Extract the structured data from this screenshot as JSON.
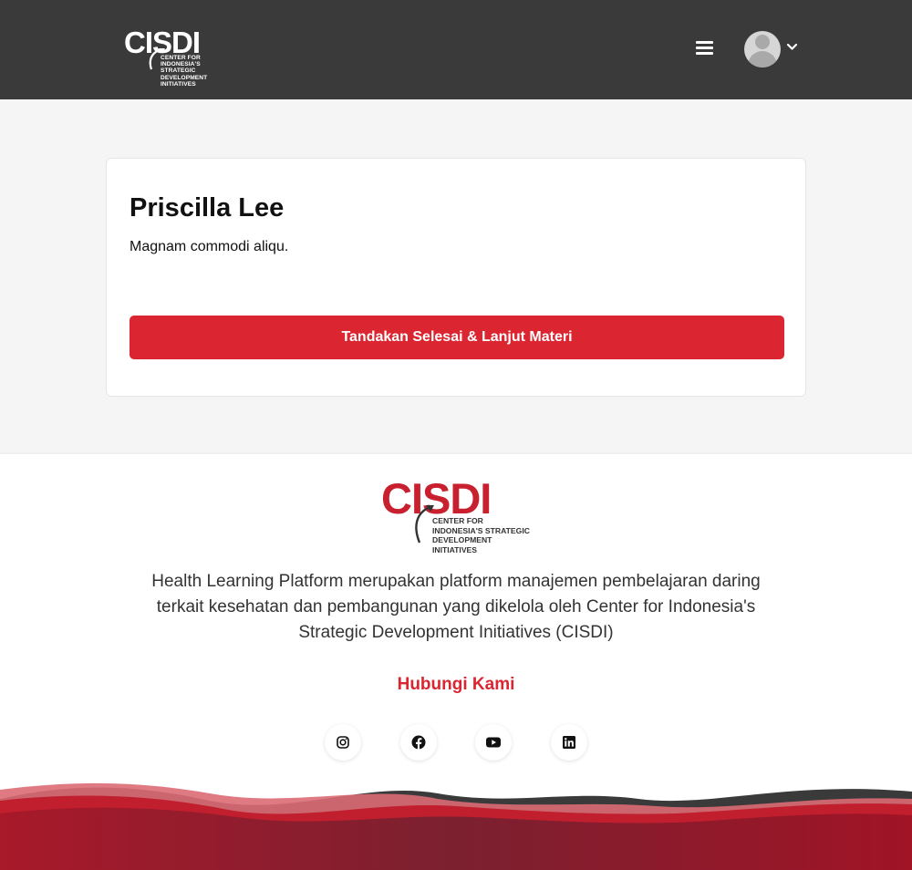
{
  "header": {
    "logo": {
      "main": "CISDI",
      "line1": "CENTER FOR",
      "line2": "INDONESIA'S STRATEGIC",
      "line3": "DEVELOPMENT INITIATIVES"
    },
    "menu_icon": "hamburger-icon",
    "avatar_icon": "user-avatar",
    "dropdown_icon": "chevron-down-icon",
    "background": "#3a3a3a"
  },
  "content": {
    "title": "Priscilla Lee",
    "body": "Magnam commodi aliqu.",
    "complete_button": "Tandakan Selesai & Lanjut Materi"
  },
  "footer": {
    "logo": {
      "main": "CISDI",
      "line1": "CENTER FOR",
      "line2": "INDONESIA'S STRATEGIC",
      "line3": "DEVELOPMENT INITIATIVES"
    },
    "description": "Health Learning Platform merupakan platform manajemen pembelajaran daring terkait kesehatan dan pembangunan yang dikelola oleh Center for Indonesia's Strategic Development Initiatives (CISDI)",
    "contact_link": "Hubungi Kami",
    "social": [
      "instagram-icon",
      "facebook-icon",
      "youtube-icon",
      "linkedin-icon"
    ]
  },
  "colors": {
    "accent": "#db2530",
    "brand_red": "#c8202e",
    "wave_dark": "#9c1a28"
  }
}
